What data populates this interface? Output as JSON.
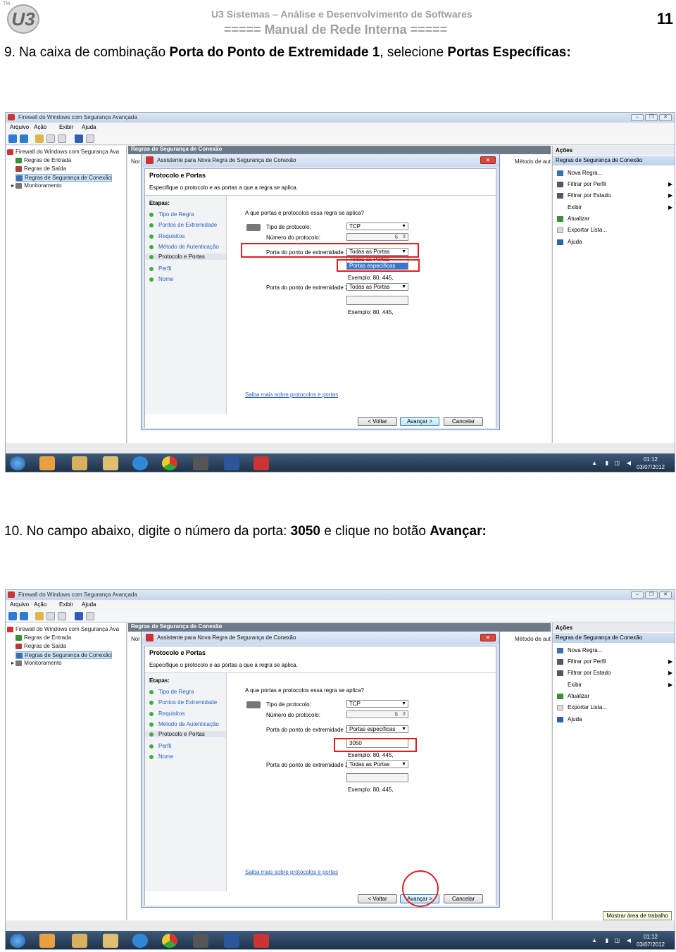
{
  "header": {
    "line1": "U3 Sistemas – Análise e Desenvolvimento de Softwares",
    "line2": "===== Manual de Rede Interna =====",
    "page_number": "11",
    "logo_tm": "TM",
    "logo_text": "U3"
  },
  "step9": {
    "number": "9.",
    "text_a": " Na caixa de combinação ",
    "text_b": "Porta do Ponto de Extremidade 1",
    "text_c": ", selecione ",
    "text_d": "Portas Específicas:"
  },
  "step10": {
    "number": "10.",
    "text_a": " No campo abaixo, digite o número da porta: ",
    "text_b": "3050",
    "text_c": " e clique no botão ",
    "text_d": "Avançar:"
  },
  "window": {
    "title": "Firewall do Windows com Segurança Avançada",
    "menu": [
      "Arquivo",
      "Ação",
      "Exibir",
      "Ajuda"
    ],
    "tree": [
      "Firewall do Windows com Segurança Ava",
      "Regras de Entrada",
      "Regras de Saída",
      "Regras de Segurança de Conexão",
      "Monitoramento"
    ],
    "mid_header": "Regras de Segurança de Conexão",
    "mid_col1": "Nor",
    "mid_col2": "Método de aut",
    "scroll_label": "III",
    "actions_header": "Ações",
    "actions_sub": "Regras de Segurança de Conexão",
    "actions": [
      "Nova Regra...",
      "Filtrar por Perfil",
      "Filtrar por Estado",
      "Exibir",
      "Atualizar",
      "Exportar Lista...",
      "Ajuda"
    ],
    "clock_time": "01:12",
    "clock_date": "03/07/2012",
    "show_desktop": "Mostrar área de trabalho"
  },
  "wizard": {
    "title": "Assistente para Nova Regra de Segurança de Conexão",
    "heading": "Protocolo e Portas",
    "subheading": "Especifique o protocolo e as portas a que a regra se aplica.",
    "steps_header": "Etapas:",
    "steps": [
      "Tipo de Regra",
      "Pontos de Extremidade",
      "Requisitos",
      "Método de Autenticação",
      "Protocolo e Portas",
      "Perfil",
      "Nome"
    ],
    "current_step": "Protocolo e Portas",
    "question": "A que portas e protocolos essa regra se aplica?",
    "protocol_type_label": "Tipo de protocolo:",
    "protocol_type_value": "TCP",
    "protocol_number_label": "Número do protocolo:",
    "protocol_number_value": "6",
    "endpoint1_label": "Porta do ponto de extremidade 1:",
    "endpoint2_label": "Porta do ponto de extremidade 2:",
    "endpoint2_value": "Todas as Portas",
    "example": "Exemplo: 80, 445,",
    "learn_more": "Saiba mais sobre protocolos e portas",
    "back": "< Voltar",
    "next": "Avançar >",
    "cancel": "Cancelar"
  },
  "shot1": {
    "endpoint1_value": "Todas as Portas",
    "options": [
      "Todas as Portas",
      "Portas específicas"
    ],
    "highlighted_option": "Portas específicas"
  },
  "shot2": {
    "endpoint1_value": "Portas específicas",
    "port_input": "3050"
  }
}
